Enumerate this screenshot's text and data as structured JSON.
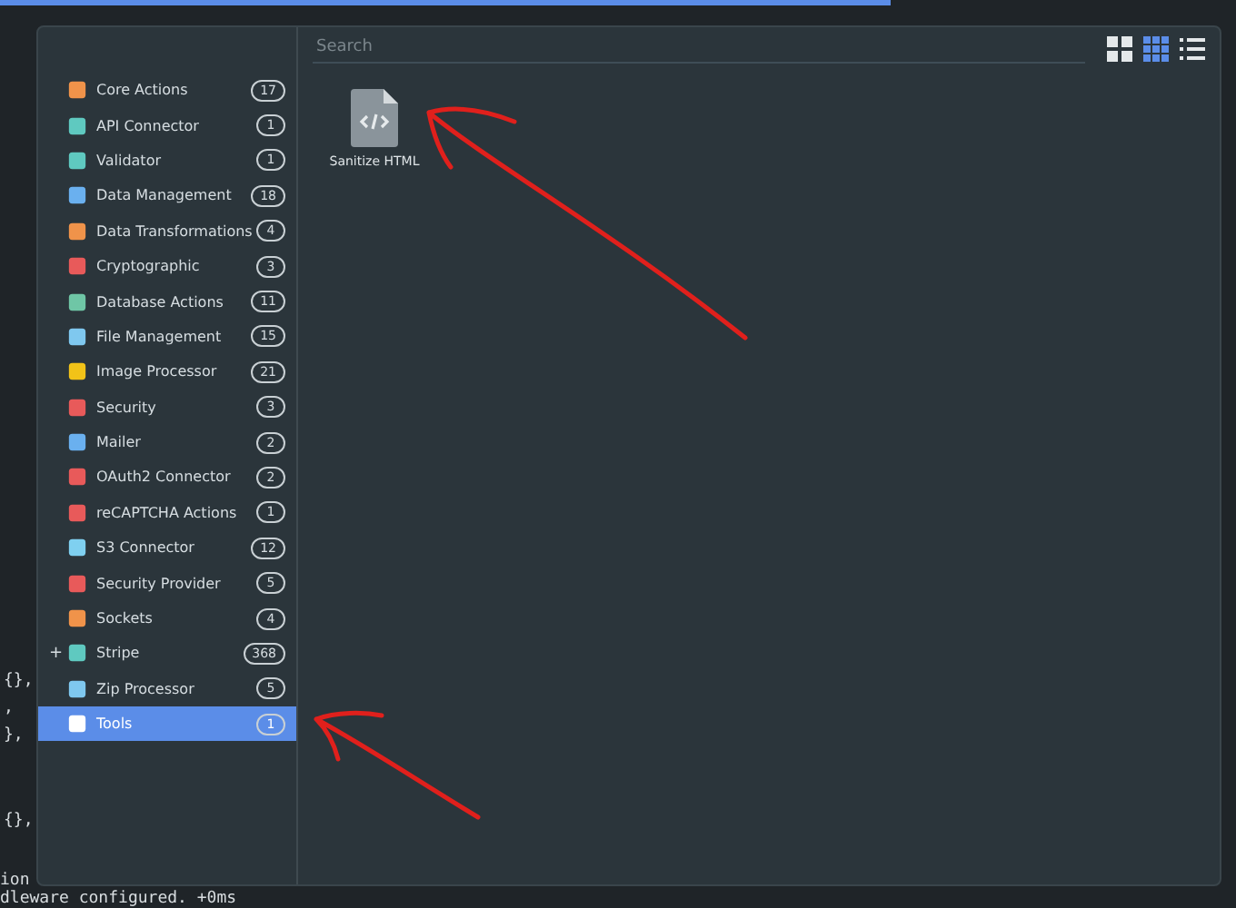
{
  "background_editor": {
    "lines": [
      {
        "text": "{},"
      },
      {
        "text": ","
      },
      {
        "text": "},"
      },
      {
        "text": "{},"
      },
      {
        "text": "ion"
      },
      {
        "text": "dleware configured. +0ms"
      }
    ]
  },
  "dialog": {
    "sidebar": {
      "items": [
        {
          "label": "Core Actions",
          "count": "17",
          "selected": false
        },
        {
          "label": "API Connector",
          "count": "1",
          "selected": false
        },
        {
          "label": "Validator",
          "count": "1",
          "selected": false
        },
        {
          "label": "Data Management",
          "count": "18",
          "selected": false
        },
        {
          "label": "Data Transformations",
          "count": "4",
          "selected": false
        },
        {
          "label": "Cryptographic",
          "count": "3",
          "selected": false
        },
        {
          "label": "Database Actions",
          "count": "11",
          "selected": false
        },
        {
          "label": "File Management",
          "count": "15",
          "selected": false
        },
        {
          "label": "Image Processor",
          "count": "21",
          "selected": false
        },
        {
          "label": "Security",
          "count": "3",
          "selected": false
        },
        {
          "label": "Mailer",
          "count": "2",
          "selected": false
        },
        {
          "label": "OAuth2 Connector",
          "count": "2",
          "selected": false
        },
        {
          "label": "reCAPTCHA Actions",
          "count": "1",
          "selected": false
        },
        {
          "label": "S3 Connector",
          "count": "12",
          "selected": false
        },
        {
          "label": "Security Provider",
          "count": "5",
          "selected": false
        },
        {
          "label": "Sockets",
          "count": "4",
          "selected": false
        },
        {
          "label": "Stripe",
          "count": "368",
          "selected": false,
          "expander": "+"
        },
        {
          "label": "Zip Processor",
          "count": "5",
          "selected": false
        },
        {
          "label": "Tools",
          "count": "1",
          "selected": true
        }
      ]
    },
    "search": {
      "placeholder": "Search"
    },
    "view_buttons": [
      {
        "kind": "large",
        "selected": false
      },
      {
        "kind": "small",
        "selected": true
      },
      {
        "kind": "list",
        "selected": false
      }
    ],
    "results": [
      {
        "label": "Sanitize HTML"
      }
    ]
  }
}
